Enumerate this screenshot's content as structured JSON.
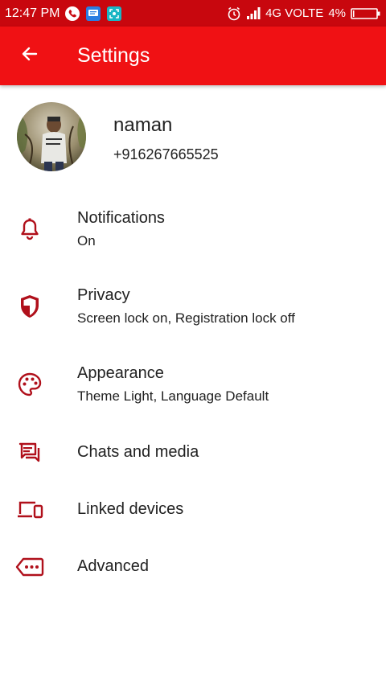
{
  "status_bar": {
    "time": "12:47 PM",
    "network": "4G VOLTE",
    "battery": "4%",
    "icons": [
      "call-icon",
      "message-icon",
      "screenshot-icon",
      "alarm-icon",
      "signal-icon",
      "battery-icon"
    ]
  },
  "app_bar": {
    "title": "Settings",
    "back_icon": "arrow-left-icon"
  },
  "profile": {
    "name": "naman",
    "phone": "+916267665525"
  },
  "settings": [
    {
      "title": "Notifications",
      "subtitle": "On",
      "icon": "bell-icon"
    },
    {
      "title": "Privacy",
      "subtitle": "Screen lock on, Registration lock off",
      "icon": "shield-icon"
    },
    {
      "title": "Appearance",
      "subtitle": "Theme Light, Language Default",
      "icon": "palette-icon"
    },
    {
      "title": "Chats and media",
      "icon": "chat-icon"
    },
    {
      "title": "Linked devices",
      "icon": "devices-icon"
    },
    {
      "title": "Advanced",
      "icon": "advanced-icon"
    }
  ],
  "colors": {
    "status_bar": "#c8070e",
    "app_bar": "#f01114",
    "icon_accent": "#b0101b",
    "text": "#212121"
  }
}
